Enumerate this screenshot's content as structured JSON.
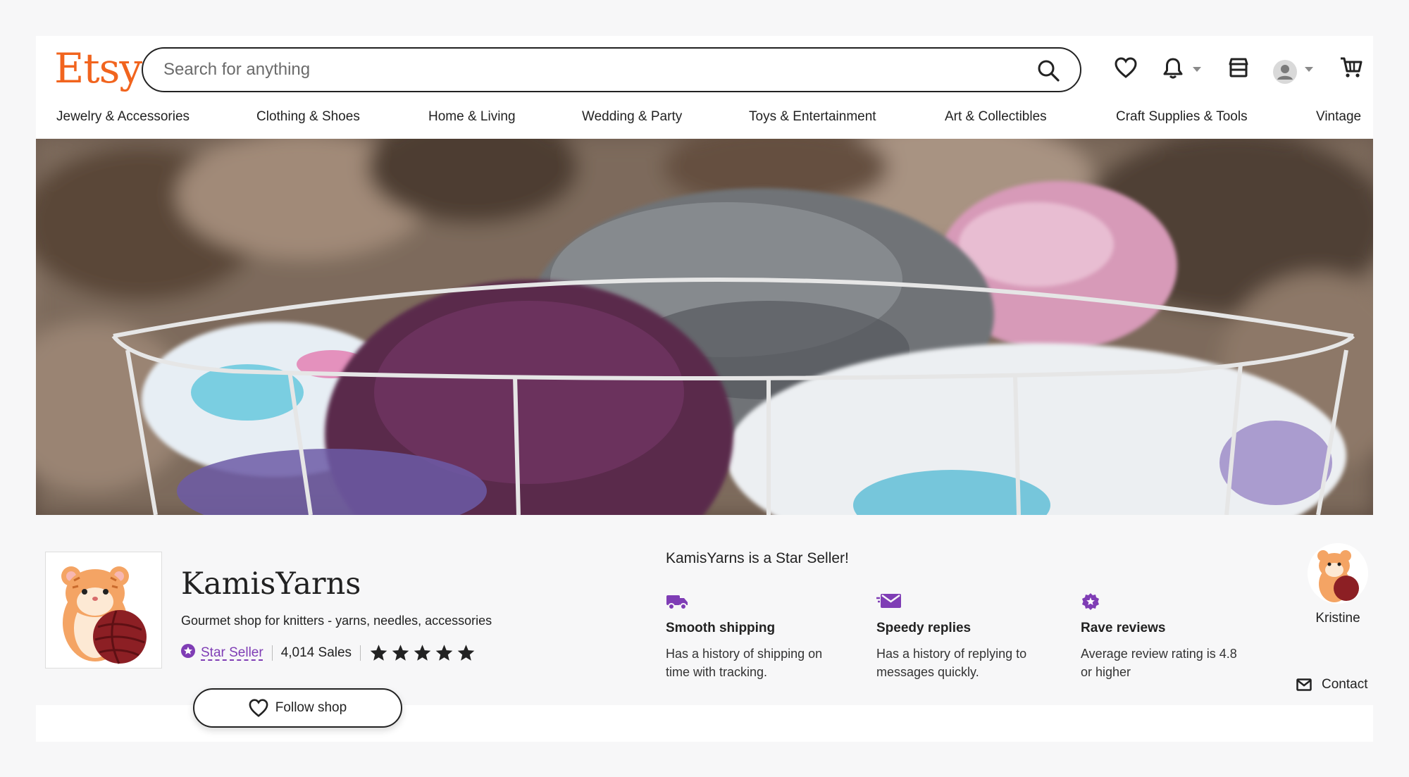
{
  "header": {
    "logo": "Etsy",
    "search_placeholder": "Search for anything"
  },
  "nav": [
    "Jewelry & Accessories",
    "Clothing & Shoes",
    "Home & Living",
    "Wedding & Party",
    "Toys & Entertainment",
    "Art & Collectibles",
    "Craft Supplies & Tools",
    "Vintage"
  ],
  "shop": {
    "name": "KamisYarns",
    "tagline": "Gourmet shop for knitters - yarns, needles, accessories",
    "badge": "Star Seller",
    "sales": "4,014 Sales",
    "rating_stars": 5,
    "follow_label": "Follow shop"
  },
  "star_seller": {
    "title": "KamisYarns is a Star Seller!",
    "features": [
      {
        "title": "Smooth shipping",
        "desc": "Has a history of shipping on time with tracking."
      },
      {
        "title": "Speedy replies",
        "desc": "Has a history of replying to messages quickly."
      },
      {
        "title": "Rave reviews",
        "desc": "Average review rating is 4.8 or higher"
      }
    ]
  },
  "owner": {
    "name": "Kristine",
    "contact_label": "Contact"
  },
  "colors": {
    "brand": "#f1641e",
    "star_seller_purple": "#7f3db5"
  }
}
